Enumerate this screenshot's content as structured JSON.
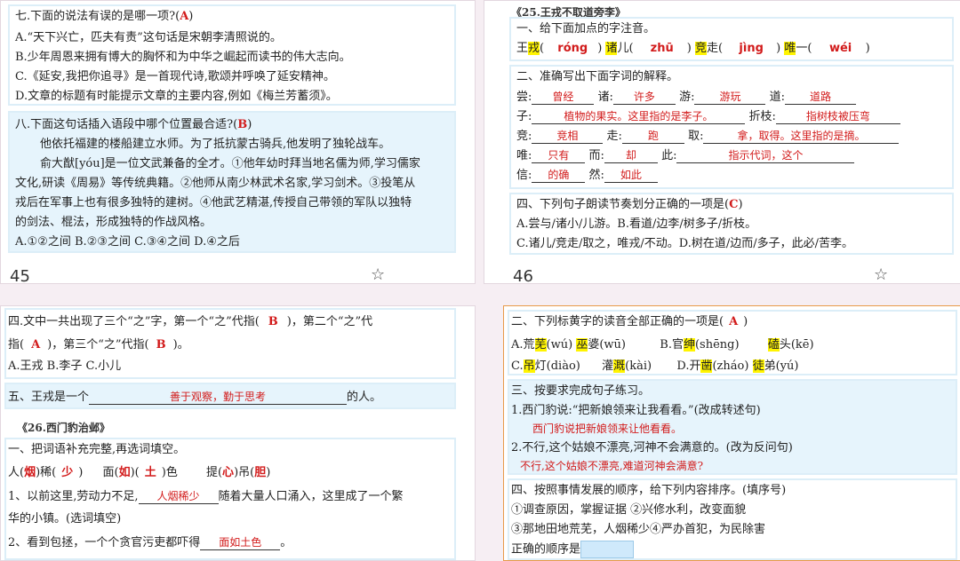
{
  "p45": {
    "q7": {
      "title": "七.下面的说法有误的是哪一项?(",
      "answer": "A",
      "close": ")",
      "lines": [
        "A.“天下兴亡，匹夫有责”这句话是宋朝李清照说的。",
        "B.少年周恩来拥有博大的胸怀和为中华之崛起而读书的伟大志向。",
        "C.《延安,我把你追寻》是一首现代诗,歌颂并呼唤了延安精神。",
        "D.文章的标题有时能提示文章的主要内容,例如《梅兰芳蓄须》。"
      ]
    },
    "q8": {
      "title": "八.下面这句话插入语段中哪个位置最合适?(",
      "answer": "B",
      "close": ")",
      "lines": [
        "他依托福建的楼船建立水师。为了抵抗蒙古骑兵,他发明了独轮战车。",
        "俞大猷[yóu]是一位文武兼备的全才。①他年幼时拜当地名儒为师,学习儒家",
        "文化,研读《周易》等传统典籍。②他师从南少林武术名家,学习剑术。③投笔从",
        "戎后在军事上也有很多独特的建树。④他武艺精湛,传授自己带领的军队以独特",
        "的剑法、棍法，形成独特的作战风格。",
        "A.①②之间  B.②③之间  C.③④之间  D.④之后"
      ]
    },
    "page_number": "45"
  },
  "p46": {
    "lesson_title": "《25.王戎不取道旁李》",
    "s1": {
      "title": "一、给下面加点的字注音。",
      "items": [
        {
          "char": "王",
          "hl": "戎",
          "pre": "(",
          "py": "róng",
          "post": ")"
        },
        {
          "char": "",
          "hl": "诸",
          "pre": "儿(",
          "py": "zhū",
          "post": ")"
        },
        {
          "char": "",
          "hl": "竞",
          "pre": "走(",
          "py": "jìng",
          "post": ")"
        },
        {
          "char": "",
          "hl": "唯",
          "pre": "一(",
          "py": "wéi",
          "post": ")"
        }
      ]
    },
    "s2": {
      "title": "二、准确写出下面字词的解释。",
      "row1": [
        {
          "w": "尝:",
          "a": "曾经"
        },
        {
          "w": "诸:",
          "a": "许多"
        },
        {
          "w": "游:",
          "a": "游玩"
        },
        {
          "w": "道:",
          "a": "道路"
        }
      ],
      "row2": [
        {
          "w": "子:",
          "a": "植物的果实。这里指的是李子。"
        },
        {
          "w": "折枝:",
          "a": "指树枝被压弯"
        }
      ],
      "row3": [
        {
          "w": "竞:",
          "a": "竞相"
        },
        {
          "w": "走:",
          "a": "跑"
        },
        {
          "w": "取:",
          "a": "拿，取得。这里指的是摘。"
        }
      ],
      "row4": [
        {
          "w": "唯:",
          "a": "只有"
        },
        {
          "w": "而:",
          "a": "却"
        },
        {
          "w": "此:",
          "a": "指示代词，这个"
        }
      ],
      "row5": [
        {
          "w": "信:",
          "a": "的确"
        },
        {
          "w": "然:",
          "a": "如此"
        }
      ]
    },
    "s4": {
      "title": "四、下列句子朗读节奏划分正确的一项是(",
      "answer": "C",
      "close": ")",
      "lines": [
        "A.尝与/诸小/儿游。B.看道/边李/树多子/折枝。",
        "C.诸儿/竞走/取之，唯戎/不动。D.树在道/边而/多子，此必/苦李。"
      ]
    },
    "page_number": "46"
  },
  "p47": {
    "q4_line1_a": "四.文中一共出现了三个“之”字，第一个“之”代指(",
    "q4_ans1": "B",
    "q4_line1_b": ")，第二个“之”代",
    "q4_line2_a": "指(",
    "q4_ans2": "A",
    "q4_line2_b": ")，第三个“之”代指(",
    "q4_ans3": "B",
    "q4_line2_c": ")。",
    "q4_options": "A.王戎  B.李子  C.小儿",
    "q5_a": "五、王戎是一个",
    "q5_ans": "善于观察，勤于思考",
    "q5_b": "的人。",
    "lesson_title": "《26.西门豹治邺》",
    "s1_title": "一、把词语补充完整,再选词填空。",
    "words": [
      {
        "pre": "人(",
        "a": "烟",
        "mid": ")稀(",
        "b": "少",
        "post": ")"
      },
      {
        "pre": "面(",
        "a": "如",
        "mid": ")(",
        "b": "土",
        "post": ")色"
      },
      {
        "pre": "提(",
        "a": "心",
        "mid": ")吊(",
        "b": "胆",
        "post": ")"
      }
    ],
    "fill1_a": "1、以前这里,劳动力不足,",
    "fill1_ans": "人烟稀少",
    "fill1_b": "随着大量人口涌入，这里成了一个繁",
    "fill1_c": "华的小镇。(选词填空)",
    "fill2_a": "2、看到包拯，一个个贪官污吏都吓得",
    "fill2_ans": "面如土色",
    "fill2_b": "。"
  },
  "p48": {
    "q2_title": "二、下列标黄字的读音全部正确的一项是(",
    "q2_answer": "A",
    "q2_close": ")",
    "optA": [
      {
        "t": "A.荒",
        "h": "芜",
        "p": "(wú) "
      },
      {
        "t": "",
        "h": "巫",
        "p": "婆(wū)"
      }
    ],
    "optB": [
      {
        "t": "B.官",
        "h": "绅",
        "p": "(shēng)"
      },
      {
        "t": "",
        "h": "磕",
        "p": "头(kē)"
      }
    ],
    "optC": [
      {
        "t": "C.",
        "h": "吊",
        "p": "灯(diào)"
      },
      {
        "t": "灌",
        "h": "溉",
        "p": "(kài)"
      }
    ],
    "optD": [
      {
        "t": "D.开",
        "h": "凿",
        "p": "(zháo)"
      },
      {
        "t": "",
        "h": "徒",
        "p": "弟(yú)"
      }
    ],
    "q3_title": "三、按要求完成句子练习。",
    "q3_1": "1.西门豹说:“把新娘领来让我看看。”(改成转述句)",
    "q3_1_ans": "西门豹说把新娘领来让他看看。",
    "q3_2": "2.不行,这个姑娘不漂亮,河神不会满意的。(改为反问句)",
    "q3_2_ans": "不行,这个姑娘不漂亮,难道河神会满意?",
    "q4_title": "四、按照事情发展的顺序，给下列内容排序。(填序号)",
    "q4_l1": "①调查原因，掌握证据  ②兴修水利，改变面貌",
    "q4_l2": "③那地田地荒芜，人烟稀少④严办首犯，为民除害",
    "q4_l3": "正确的顺序是"
  }
}
